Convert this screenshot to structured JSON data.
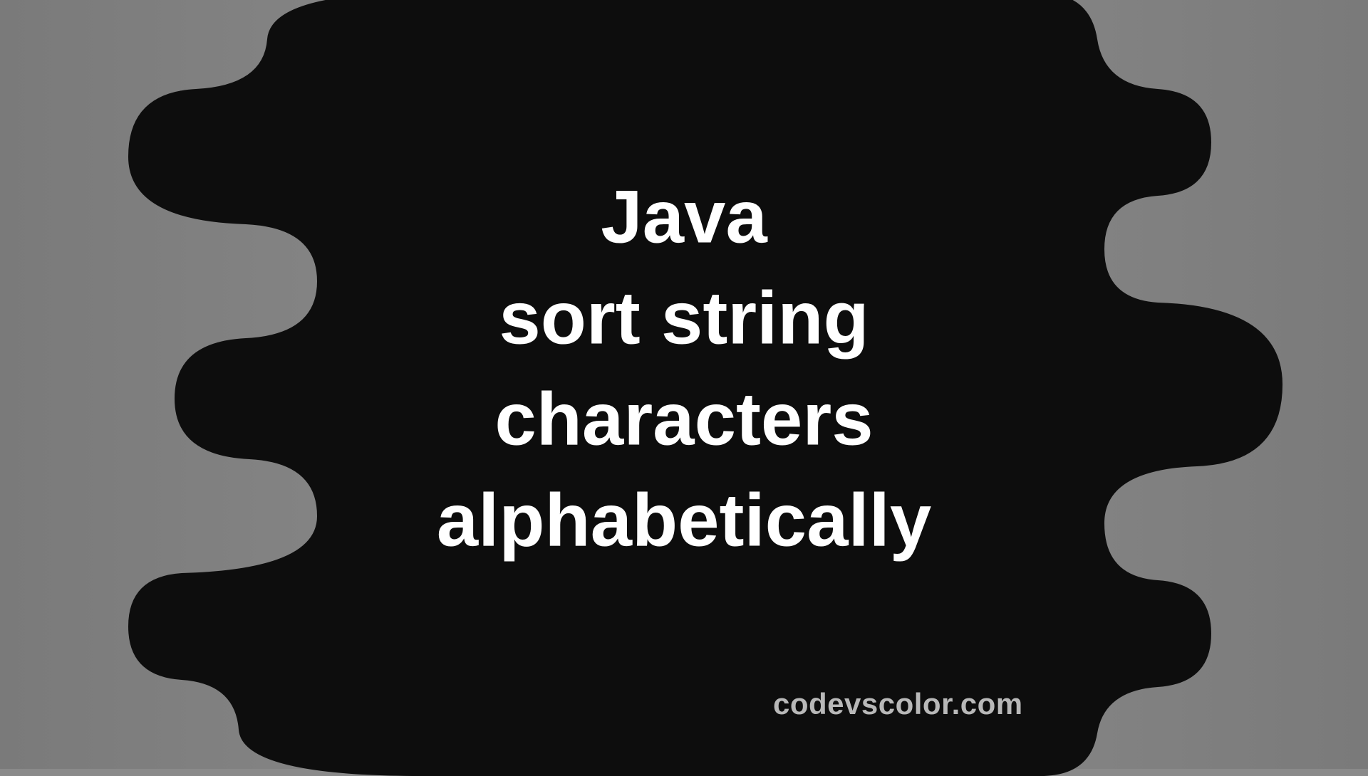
{
  "title_lines": "Java\nsort string\ncharacters\nalphabetically",
  "watermark_text": "codevscolor.com",
  "colors": {
    "background": "#8a8a8a",
    "blob": "#0d0d0d",
    "text": "#ffffff",
    "watermark": "#b8b8b8"
  }
}
